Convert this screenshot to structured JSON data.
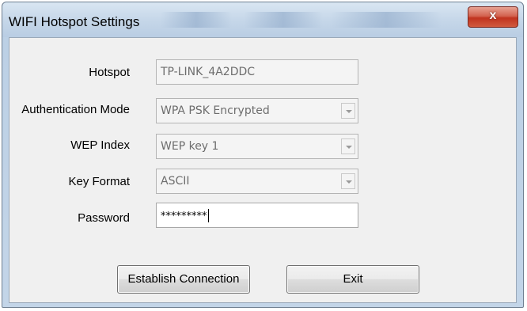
{
  "window": {
    "title": "WIFI Hotspot Settings",
    "close_glyph": "x"
  },
  "form": {
    "hotspot": {
      "label": "Hotspot",
      "value": "TP-LINK_4A2DDC"
    },
    "auth_mode": {
      "label": "Authentication Mode",
      "value": "WPA PSK Encrypted"
    },
    "wep_index": {
      "label": "WEP Index",
      "value": "WEP key 1"
    },
    "key_format": {
      "label": "Key Format",
      "value": "ASCII"
    },
    "password": {
      "label": "Password",
      "value": "*********"
    }
  },
  "buttons": {
    "establish": "Establish  Connection",
    "exit": "Exit"
  },
  "colors": {
    "close_button": "#c7402a",
    "client_background": "#f0f0f0",
    "frame": "#bcd0e5"
  }
}
